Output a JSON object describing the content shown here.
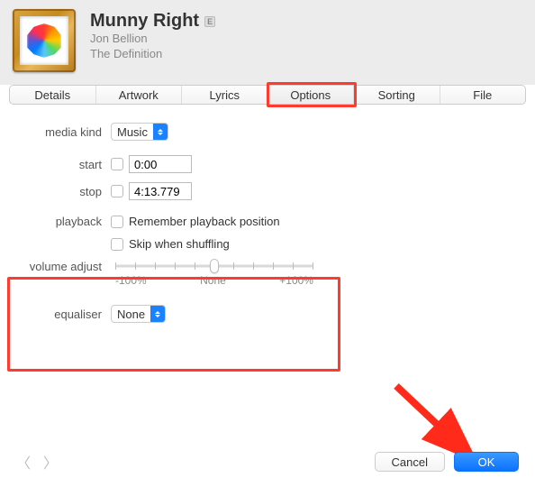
{
  "header": {
    "title": "Munny Right",
    "explicit_badge": "E",
    "artist": "Jon Bellion",
    "album": "The Definition"
  },
  "tabs": [
    "Details",
    "Artwork",
    "Lyrics",
    "Options",
    "Sorting",
    "File"
  ],
  "selected_tab": "Options",
  "options": {
    "labels": {
      "media_kind": "media kind",
      "start": "start",
      "stop": "stop",
      "playback": "playback",
      "volume_adjust": "volume adjust",
      "equaliser": "equaliser"
    },
    "media_kind_value": "Music",
    "start_checked": false,
    "start_value": "0:00",
    "stop_checked": false,
    "stop_value": "4:13.779",
    "remember_position_label": "Remember playback position",
    "remember_position_checked": false,
    "skip_shuffle_label": "Skip when shuffling",
    "skip_shuffle_checked": false,
    "volume_labels": {
      "min": "-100%",
      "mid": "None",
      "max": "+100%"
    },
    "equaliser_value": "None"
  },
  "footer": {
    "cancel": "Cancel",
    "ok": "OK"
  },
  "annotations": {
    "highlight_tab": "Options",
    "highlight_section": "volume-equaliser",
    "arrow_target": "ok-button"
  }
}
